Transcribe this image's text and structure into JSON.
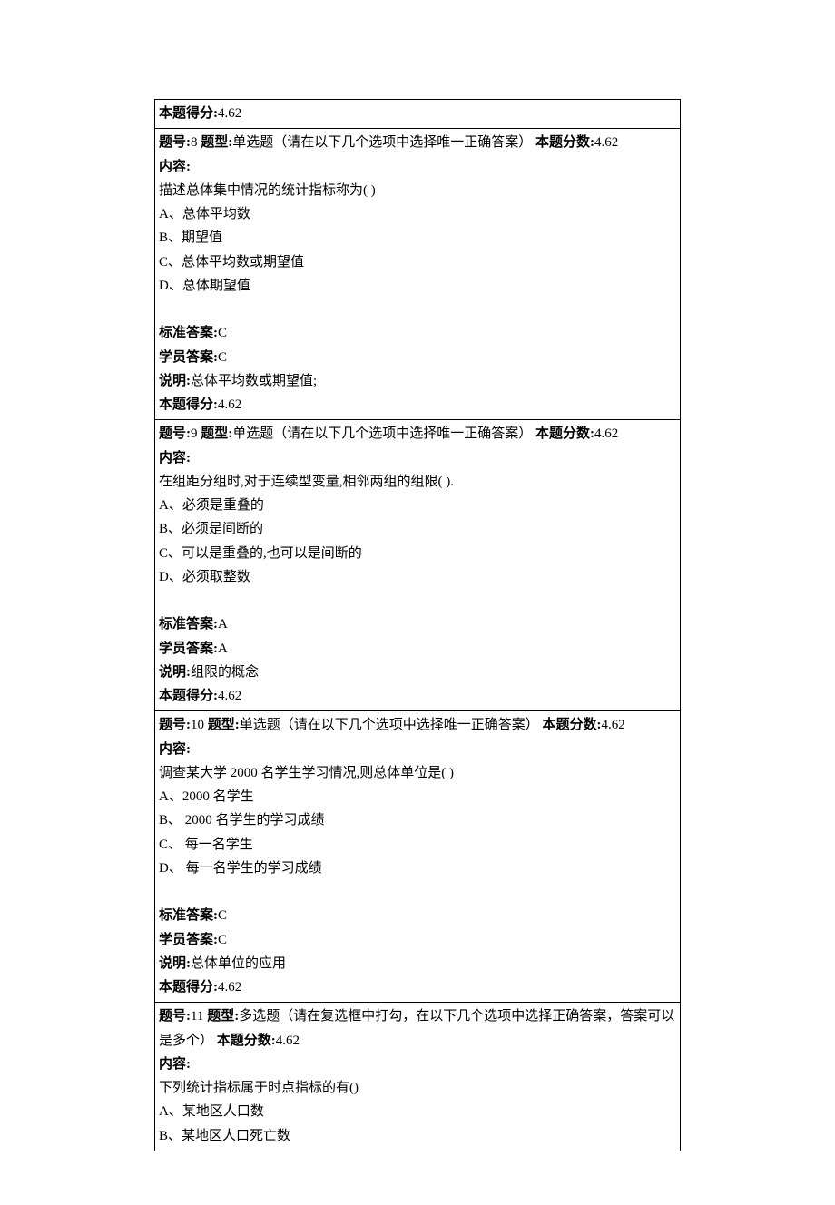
{
  "labels": {
    "score_earned": "本题得分:",
    "qnum": "题号:",
    "qtype": "题型:",
    "qscore": "本题分数:",
    "content": "内容:",
    "std_answer": "标准答案:",
    "stu_answer": "学员答案:",
    "explain": "说明:"
  },
  "top_cell": {
    "score_earned": "4.62"
  },
  "questions": [
    {
      "num": "8",
      "type": "单选题（请在以下几个选项中选择唯一正确答案）",
      "qscore": "4.62",
      "stem": "描述总体集中情况的统计指标称为( )",
      "options": [
        "A、总体平均数",
        "B、期望值",
        "C、总体平均数或期望值",
        "D、总体期望值"
      ],
      "std_answer": "C",
      "stu_answer": "C",
      "explain": "总体平均数或期望值;",
      "score_earned": "4.62"
    },
    {
      "num": "9",
      "type": "单选题（请在以下几个选项中选择唯一正确答案）",
      "qscore": "4.62",
      "stem": "在组距分组时,对于连续型变量,相邻两组的组限( ).",
      "options": [
        "A、必须是重叠的",
        "B、必须是间断的",
        "C、可以是重叠的,也可以是间断的",
        "D、必须取整数"
      ],
      "std_answer": "A",
      "stu_answer": "A",
      "explain": "组限的概念",
      "score_earned": "4.62"
    },
    {
      "num": "10",
      "type": "单选题（请在以下几个选项中选择唯一正确答案）",
      "qscore": "4.62",
      "stem": "调查某大学 2000 名学生学习情况,则总体单位是( )",
      "options": [
        "A、2000 名学生",
        "B、 2000 名学生的学习成绩",
        "C、 每一名学生",
        "D、 每一名学生的学习成绩"
      ],
      "std_answer": "C",
      "stu_answer": "C",
      "explain": "总体单位的应用",
      "score_earned": "4.62"
    },
    {
      "num": "11",
      "type": "多选题（请在复选框中打勾，在以下几个选项中选择正确答案，答案可以是多个）",
      "qscore": "4.62",
      "stem": "下列统计指标属于时点指标的有()",
      "options": [
        "A、某地区人口数",
        "B、某地区人口死亡数"
      ]
    }
  ]
}
